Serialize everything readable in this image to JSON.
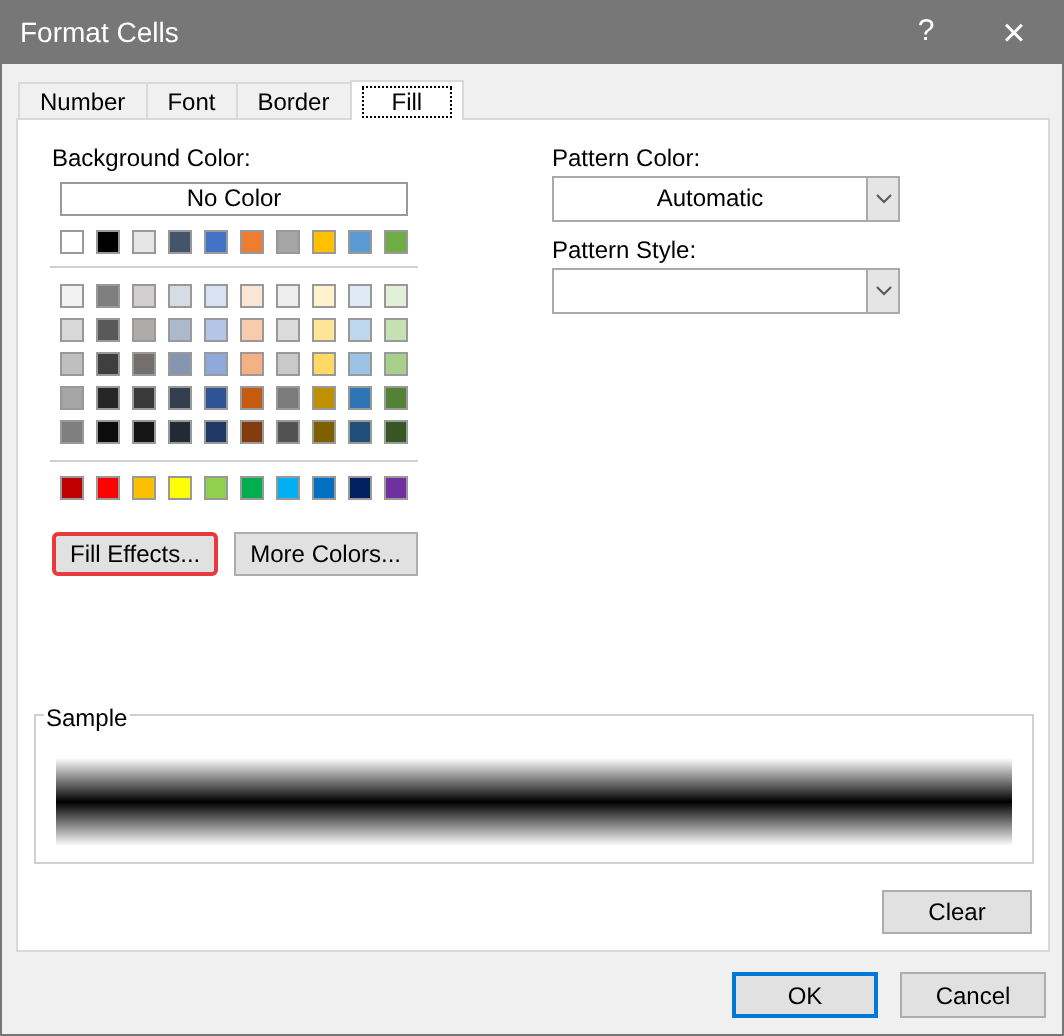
{
  "window": {
    "title": "Format Cells",
    "help": "?",
    "close": "×"
  },
  "tabs": [
    {
      "label": "Number",
      "selected": false
    },
    {
      "label": "Font",
      "selected": false
    },
    {
      "label": "Border",
      "selected": false
    },
    {
      "label": "Fill",
      "selected": true
    }
  ],
  "background_color": {
    "label": "Background Color:",
    "no_color": "No Color",
    "theme_row": [
      {
        "color": "#ffffff"
      },
      {
        "color": "#000000"
      },
      {
        "color": "#e7e6e6"
      },
      {
        "color": "#44546a"
      },
      {
        "color": "#4472c4"
      },
      {
        "color": "#ed7d31"
      },
      {
        "color": "#a5a5a5"
      },
      {
        "color": "#ffc000"
      },
      {
        "color": "#5b9bd5"
      },
      {
        "color": "#70ad47"
      }
    ],
    "shade_rows": [
      [
        {
          "color": "#f2f2f2"
        },
        {
          "color": "#7f7f7f"
        },
        {
          "color": "#d0cece"
        },
        {
          "color": "#d6dce4"
        },
        {
          "color": "#d9e2f3"
        },
        {
          "color": "#fbe5d5"
        },
        {
          "color": "#ededed"
        },
        {
          "color": "#fff2cc"
        },
        {
          "color": "#deebf6"
        },
        {
          "color": "#e2efd9"
        }
      ],
      [
        {
          "color": "#d8d8d8"
        },
        {
          "color": "#595959"
        },
        {
          "color": "#aeabab"
        },
        {
          "color": "#adb9ca"
        },
        {
          "color": "#b4c6e7"
        },
        {
          "color": "#f7cbac"
        },
        {
          "color": "#dbdbdb"
        },
        {
          "color": "#fee599"
        },
        {
          "color": "#bdd7ee"
        },
        {
          "color": "#c5e0b3"
        }
      ],
      [
        {
          "color": "#bfbfbf"
        },
        {
          "color": "#3f3f3f"
        },
        {
          "color": "#757070"
        },
        {
          "color": "#8496b0"
        },
        {
          "color": "#8eaadb"
        },
        {
          "color": "#f4b183"
        },
        {
          "color": "#c9c9c9"
        },
        {
          "color": "#ffd965"
        },
        {
          "color": "#9cc3e5"
        },
        {
          "color": "#a8d08d"
        }
      ],
      [
        {
          "color": "#a5a5a5"
        },
        {
          "color": "#262626"
        },
        {
          "color": "#3a3838"
        },
        {
          "color": "#323f4f"
        },
        {
          "color": "#2f5496"
        },
        {
          "color": "#c55a11"
        },
        {
          "color": "#7b7b7b"
        },
        {
          "color": "#bf9000"
        },
        {
          "color": "#2e75b5"
        },
        {
          "color": "#538135"
        }
      ],
      [
        {
          "color": "#7f7f7f"
        },
        {
          "color": "#0c0c0c"
        },
        {
          "color": "#171616"
        },
        {
          "color": "#222a35"
        },
        {
          "color": "#1f3864"
        },
        {
          "color": "#833c0b"
        },
        {
          "color": "#525252"
        },
        {
          "color": "#7f6000"
        },
        {
          "color": "#1e4e79"
        },
        {
          "color": "#375623"
        }
      ]
    ],
    "standard_row": [
      {
        "color": "#c00000"
      },
      {
        "color": "#ff0000"
      },
      {
        "color": "#ffc000"
      },
      {
        "color": "#ffff00"
      },
      {
        "color": "#92d050"
      },
      {
        "color": "#00b050"
      },
      {
        "color": "#00b0f0"
      },
      {
        "color": "#0070c0"
      },
      {
        "color": "#002060"
      },
      {
        "color": "#7030a0"
      }
    ],
    "buttons": [
      {
        "label": "Fill Effects...",
        "highlighted": true
      },
      {
        "label": "More Colors...",
        "highlighted": false
      }
    ]
  },
  "pattern_color": {
    "label": "Pattern Color:",
    "value": "Automatic"
  },
  "pattern_style": {
    "label": "Pattern Style:"
  },
  "sample": {
    "label": "Sample"
  },
  "clear_button": "Clear",
  "footer_buttons": [
    {
      "label": "OK",
      "default": true
    },
    {
      "label": "Cancel",
      "default": false
    }
  ]
}
